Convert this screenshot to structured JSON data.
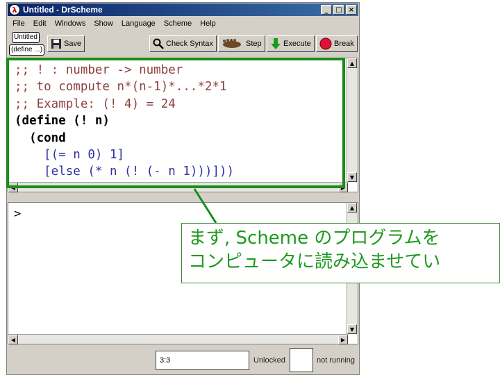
{
  "window": {
    "title": "Untitled - DrScheme",
    "app_icon": "λ",
    "controls": {
      "minimize": "_",
      "maximize": "□",
      "close": "×"
    }
  },
  "menu": [
    "File",
    "Edit",
    "Windows",
    "Show",
    "Language",
    "Scheme",
    "Help"
  ],
  "toolbar": {
    "file_tag": "Untitled",
    "define_tag": "(define ...)",
    "save": "Save",
    "check_syntax": "Check Syntax",
    "step": "Step",
    "execute": "Execute",
    "break": "Break"
  },
  "definitions": {
    "lines": [
      ";; ! : number -> number",
      ";; to compute n*(n-1)*...*2*1",
      ";; Example: (! 4) = 24",
      "(define (! n)",
      "  (cond",
      "    [(= n 0) 1]",
      "    [else (* n (! (- n 1)))]))"
    ]
  },
  "interactions": {
    "prompt": ">"
  },
  "status": {
    "position": "3:3",
    "lock": "Unlocked",
    "run_state": "not running"
  },
  "annotation": {
    "line1": "まず, Scheme のプログラムを",
    "line2": "コンピュータに読み込ませてい",
    "color": "#1e9a1e",
    "frame_color": "#1a8c1a"
  },
  "colors": {
    "comment": "#904040",
    "paren": "#8080c0",
    "identifier": "#3030a0"
  }
}
